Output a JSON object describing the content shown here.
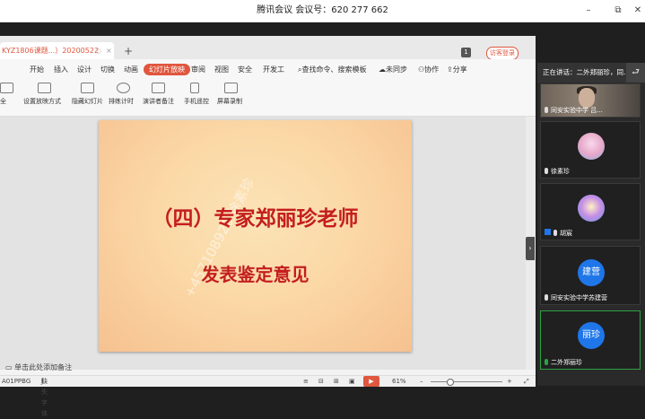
{
  "window": {
    "title": "腾讯会议 会议号：620 277 662",
    "controls": [
      "–",
      "⧉",
      "✕"
    ]
  },
  "wps": {
    "doc_tab": "KYZ1806课题...）20200522",
    "new_tab": "+",
    "badge": "1",
    "login": "访客登录",
    "menus": [
      "开始",
      "插入",
      "设计",
      "切换",
      "动画",
      "幻灯片放映",
      "审阅",
      "视图",
      "安全",
      "开发工",
      "查找命令、搜索模板",
      "未同步",
      "协作",
      "分享"
    ],
    "active_menu": "幻灯片放映",
    "tools": [
      "设置放映方式",
      "隐藏幻灯片",
      "排练计时",
      "演讲者备注",
      "手机遥控",
      "屏幕录制"
    ],
    "left_tool": "全",
    "slide": {
      "title": "（四）专家郑丽珍老师",
      "subtitle": "发表鉴定意见",
      "watermark": "+457108926 徐素珍"
    },
    "notes_hint": "单击此处添加备注",
    "status": {
      "left": "A01PPBG",
      "font": "缺失字体",
      "zoom": "61%",
      "play": "▶"
    }
  },
  "meeting": {
    "speaking": "正在讲话：二外郑丽珍，同...",
    "back": "⮐",
    "participants": [
      {
        "name": "同安实验中学 吕...",
        "avatar": ""
      },
      {
        "name": "徐素珍",
        "avatar": ""
      },
      {
        "name": "胡宸",
        "avatar": ""
      },
      {
        "name": "同安实验中学苏建营",
        "avatar": "建营"
      },
      {
        "name": "二外郑丽珍",
        "avatar": "丽珍"
      }
    ]
  },
  "colors": {
    "accent": "#e0573f",
    "slide_text": "#c41e1e",
    "active_speaker": "#2ea043",
    "avatar_blue": "#1f76e8"
  }
}
